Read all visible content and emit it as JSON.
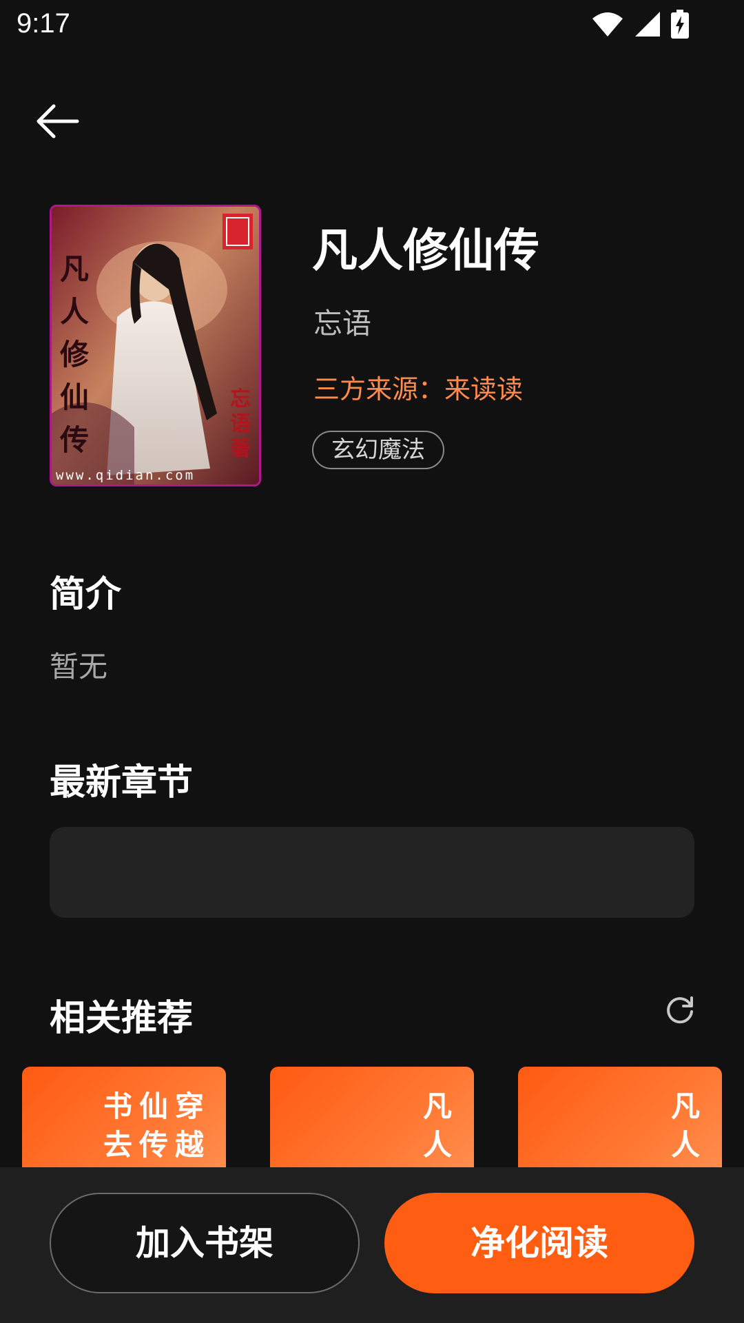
{
  "status_bar": {
    "time": "9:17"
  },
  "book": {
    "title": "凡人修仙传",
    "author": "忘语",
    "source": "三方来源：来读读",
    "tag": "玄幻魔法",
    "cover": {
      "vertical_title": "凡人修仙传",
      "author_mark": "忘语著",
      "site": "www.qidian.com"
    }
  },
  "sections": {
    "intro_title": "简介",
    "intro_text": "暂无",
    "latest_title": "最新章节",
    "recommend_title": "相关推荐"
  },
  "recommendations": [
    {
      "title_line1": "书仙穿",
      "title_line2": "去传越"
    },
    {
      "title_line1": "凡",
      "title_line2": "人"
    },
    {
      "title_line1": "凡",
      "title_line2": "人"
    }
  ],
  "actions": {
    "add_shelf": "加入书架",
    "pure_read": "净化阅读"
  },
  "colors": {
    "accent": "#ff5e12",
    "source_text": "#ff8b4d",
    "background": "#111112"
  }
}
